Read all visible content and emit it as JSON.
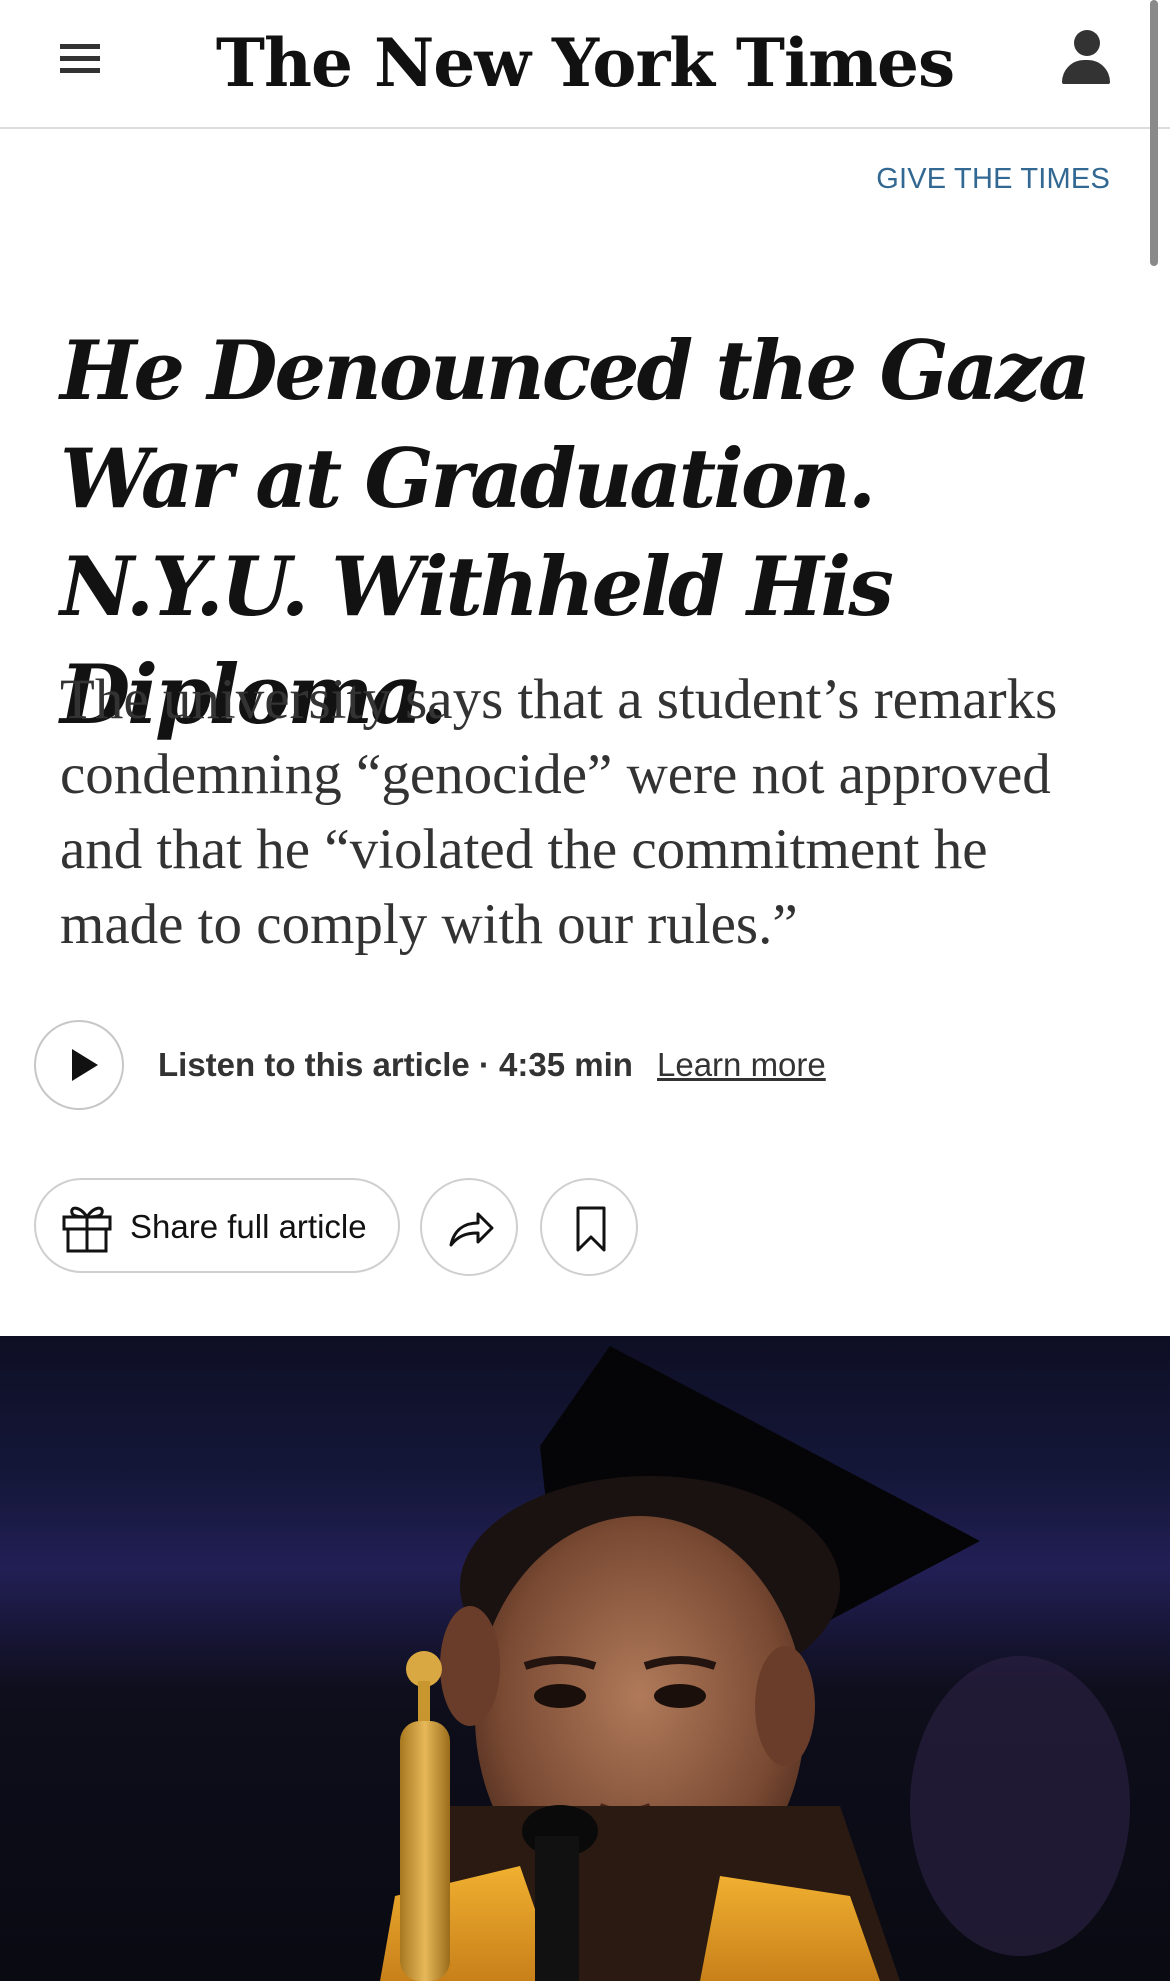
{
  "header": {
    "logo_text": "The New York Times",
    "menu_icon": "hamburger-menu-icon",
    "account_icon": "user-account-icon"
  },
  "promo": {
    "give_link": "GIVE THE TIMES"
  },
  "article": {
    "headline": "He Denounced the Gaza War at Graduation. N.Y.U. Withheld His Diploma.",
    "summary": "The university says that a student’s remarks condemning “genocide” were not approved and that he “violated the commitment he made to comply with our rules.”"
  },
  "audio": {
    "play_icon": "play-icon",
    "listen_label": "Listen to this article · 4:35 min",
    "learn_more": "Learn more"
  },
  "actions": {
    "share_full_label": "Share full article",
    "gift_icon": "gift-icon",
    "share_icon": "share-arrow-icon",
    "bookmark_icon": "bookmark-icon"
  },
  "colors": {
    "link_blue": "#326891",
    "text_dark": "#121212",
    "border_gray": "#cfcfcf"
  }
}
